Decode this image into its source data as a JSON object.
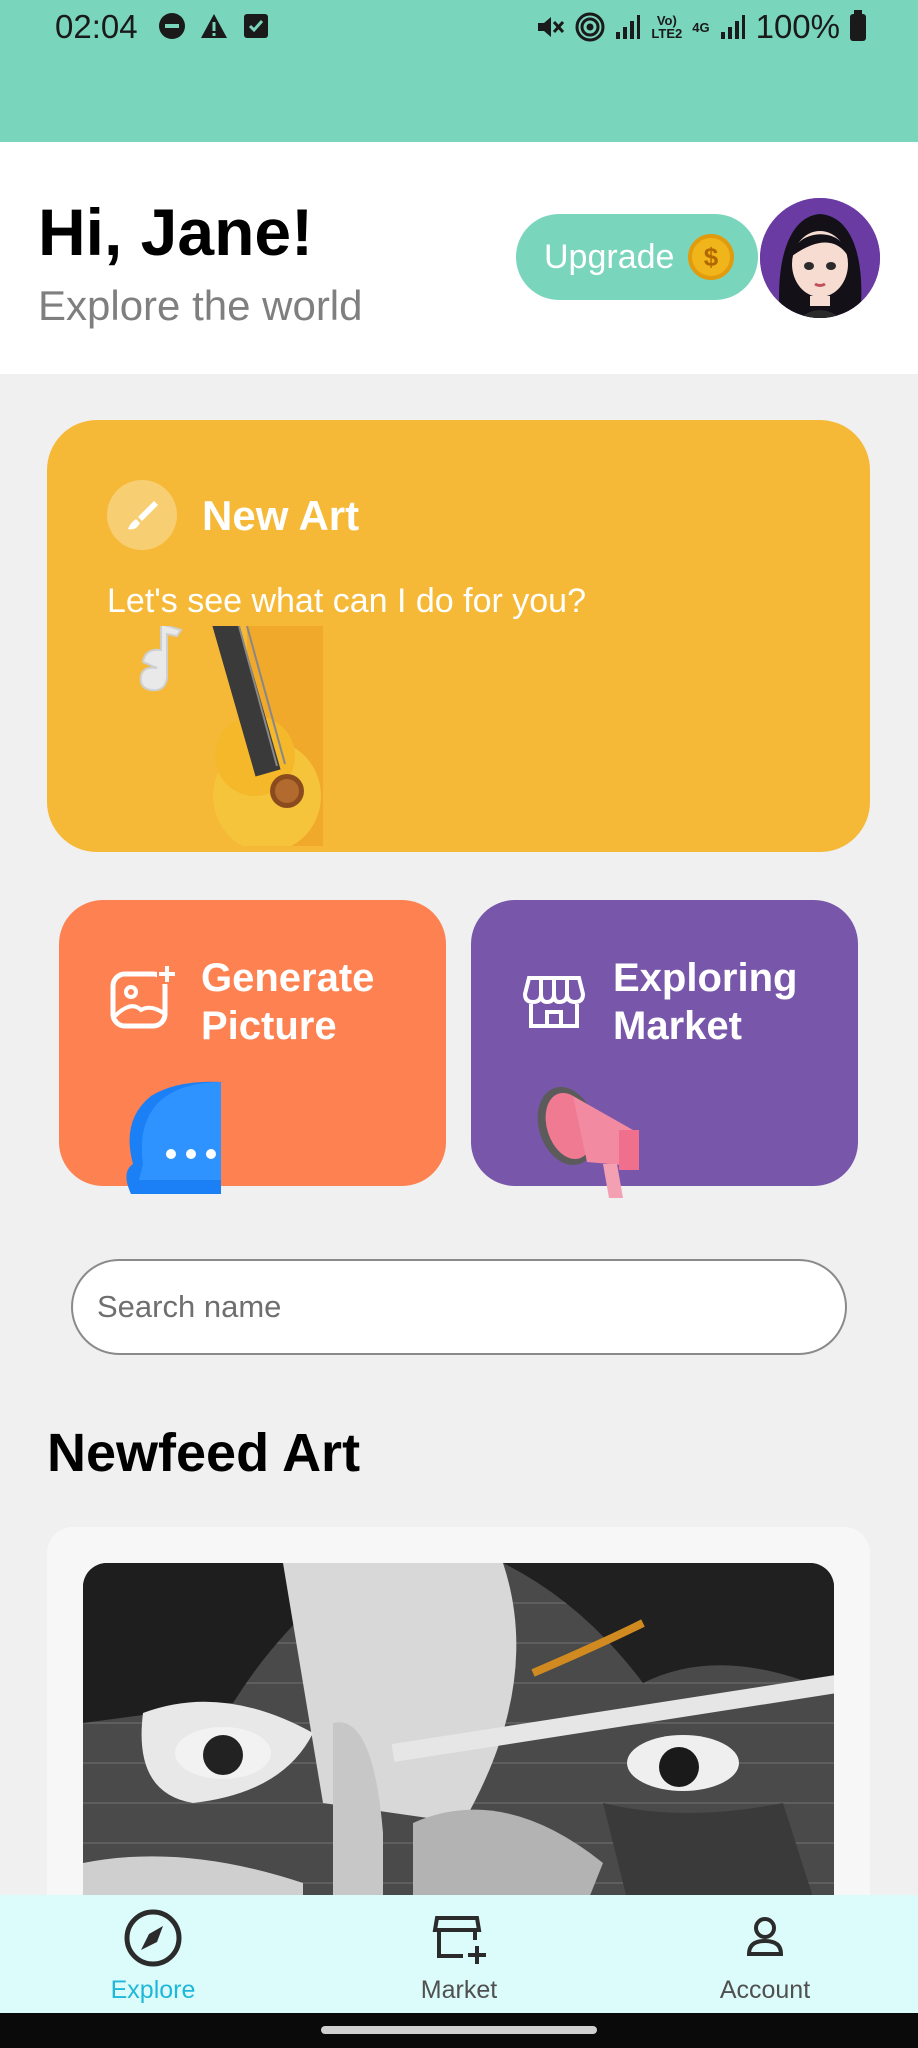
{
  "status_bar": {
    "time": "02:04",
    "network_vol": "Vo)",
    "network_lte": "LTE2",
    "network_4g": "4G",
    "battery": "100%"
  },
  "header": {
    "greeting": "Hi, Jane!",
    "subtitle": "Explore the world",
    "upgrade_label": "Upgrade",
    "coin_symbol": "$"
  },
  "new_art": {
    "title": "New Art",
    "subtitle": "Let's see what can I do for you?"
  },
  "cards": {
    "generate": {
      "line1": "Generate",
      "line2": "Picture"
    },
    "market": {
      "line1": "Exploring",
      "line2": "Market"
    }
  },
  "search": {
    "placeholder": "Search name",
    "value": ""
  },
  "feed": {
    "title": "Newfeed Art"
  },
  "nav": {
    "explore": "Explore",
    "market": "Market",
    "account": "Account",
    "active": "explore"
  },
  "colors": {
    "teal": "#79d5bb",
    "new_art": "#f5b937",
    "generate": "#fd8151",
    "market": "#7857ab",
    "nav_active": "#1fb8d9",
    "nav_bg": "#dcfcfc"
  },
  "icons": {
    "new_art": "brush-icon",
    "generate": "image-plus-icon",
    "market": "storefront-icon",
    "nav_explore": "compass-icon",
    "nav_market": "store-add-icon",
    "nav_account": "user-icon"
  }
}
